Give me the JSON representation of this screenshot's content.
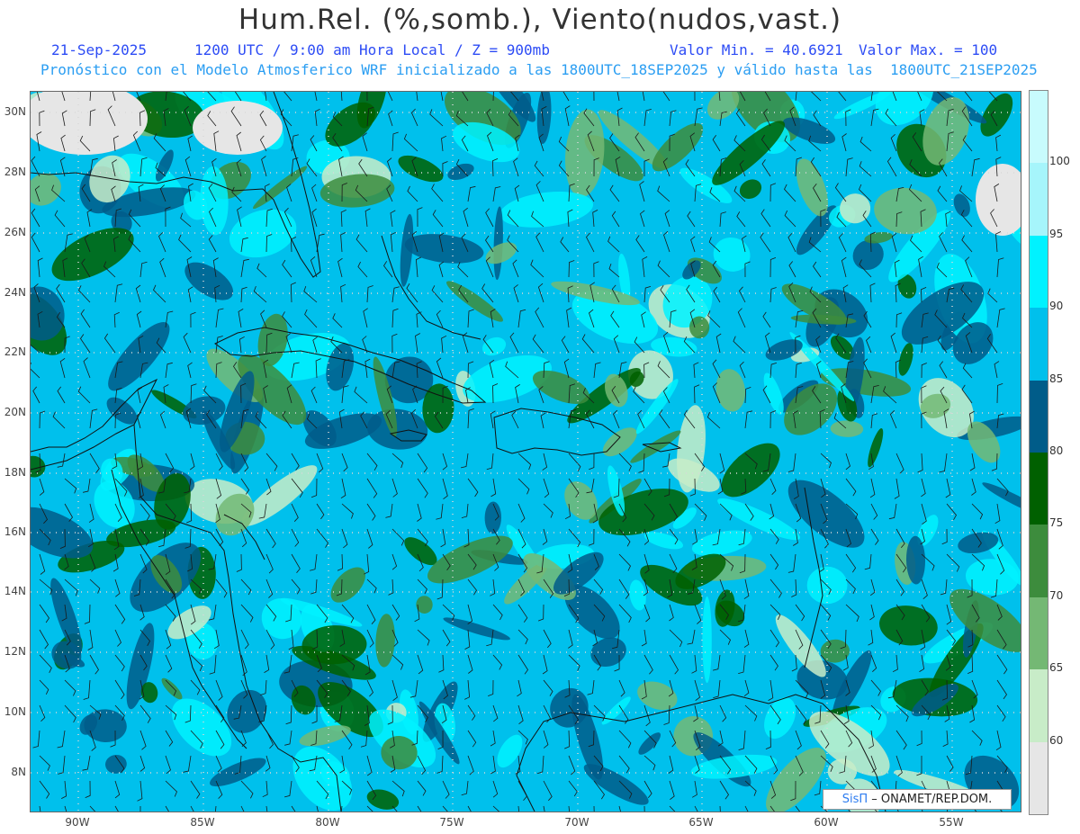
{
  "header": {
    "title": "Hum.Rel. (%,somb.), Viento(nudos,vast.)",
    "date": "21-Sep-2025",
    "time": "1200 UTC / 9:00 am Hora Local / Z = 900mb",
    "valmin": "Valor Min. = 40.6921",
    "valmax": "Valor Max. = 100",
    "model": "Pronóstico con el Modelo Atmosferico WRF inicializado a las 1800UTC_18SEP2025 y válido hasta las  1800UTC_21SEP2025"
  },
  "axes": {
    "lat_labels": [
      "30N",
      "28N",
      "26N",
      "24N",
      "22N",
      "20N",
      "18N",
      "16N",
      "14N",
      "12N",
      "10N",
      "8N"
    ],
    "lon_labels": [
      "90W",
      "85W",
      "80W",
      "75W",
      "70W",
      "65W",
      "60W",
      "55W"
    ]
  },
  "legend": {
    "labels": [
      "100",
      "95",
      "90",
      "85",
      "80",
      "75",
      "70",
      "65",
      "60"
    ],
    "colors": [
      "#a6f5fb",
      "#00f2ff",
      "#00c0ec",
      "#005c89",
      "#006000",
      "#3d8c3d",
      "#74b874",
      "#c8ecc8",
      "#e6e6e6"
    ]
  },
  "credit": {
    "brand": "SisΠ",
    "text": "– ONAMET/REP.DOM."
  },
  "colors": {
    "land_line": "#111111",
    "wind_barb": "#1a1a1a",
    "grid": "#d8d8d8"
  }
}
